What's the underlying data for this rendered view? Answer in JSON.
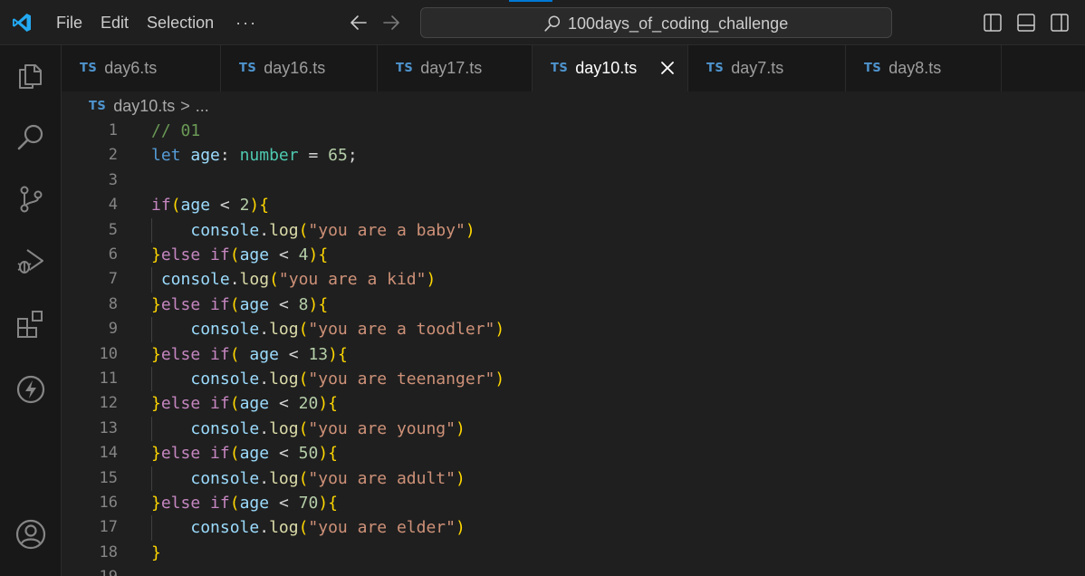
{
  "titlebar": {
    "menu": [
      "File",
      "Edit",
      "Selection",
      "···"
    ],
    "command_center_text": "100days_of_coding_challenge"
  },
  "tabs": [
    {
      "badge": "TS",
      "label": "day6.ts",
      "active": false
    },
    {
      "badge": "TS",
      "label": "day16.ts",
      "active": false
    },
    {
      "badge": "TS",
      "label": "day17.ts",
      "active": false
    },
    {
      "badge": "TS",
      "label": "day10.ts",
      "active": true
    },
    {
      "badge": "TS",
      "label": "day7.ts",
      "active": false
    },
    {
      "badge": "TS",
      "label": "day8.ts",
      "active": false
    }
  ],
  "breadcrumb": {
    "badge": "TS",
    "file": "day10.ts",
    "separator": ">",
    "rest": "..."
  },
  "code_lines": [
    {
      "n": "1",
      "text": "// 01"
    },
    {
      "n": "2",
      "text": "let age: number = 65;"
    },
    {
      "n": "3",
      "text": ""
    },
    {
      "n": "4",
      "text": "if(age < 2){"
    },
    {
      "n": "5",
      "text": "    console.log(\"you are a baby\")"
    },
    {
      "n": "6",
      "text": "}else if(age < 4){"
    },
    {
      "n": "7",
      "text": " console.log(\"you are a kid\")"
    },
    {
      "n": "8",
      "text": "}else if(age < 8){"
    },
    {
      "n": "9",
      "text": "    console.log(\"you are a toodler\")"
    },
    {
      "n": "10",
      "text": "}else if( age < 13){"
    },
    {
      "n": "11",
      "text": "    console.log(\"you are teenanger\")"
    },
    {
      "n": "12",
      "text": "}else if(age < 20){"
    },
    {
      "n": "13",
      "text": "    console.log(\"you are young\")"
    },
    {
      "n": "14",
      "text": "}else if(age < 50){"
    },
    {
      "n": "15",
      "text": "    console.log(\"you are adult\")"
    },
    {
      "n": "16",
      "text": "}else if(age < 70){"
    },
    {
      "n": "17",
      "text": "    console.log(\"you are elder\")"
    },
    {
      "n": "18",
      "text": "}"
    },
    {
      "n": "19",
      "text": ""
    }
  ],
  "colors": {
    "accent": "#0078d4",
    "ts_badge": "#4e94ce",
    "keyword": "#569cd6",
    "control": "#c586c0",
    "variable": "#9cdcfe",
    "type": "#4ec9b0",
    "number": "#b5cea8",
    "string": "#ce9178",
    "comment": "#6a9955",
    "function": "#dcdcaa",
    "bracket_1": "#ffd700",
    "bracket_2": "#da70d6"
  },
  "icons": {
    "activitybar": [
      "explorer-icon",
      "search-icon",
      "source-control-icon",
      "run-debug-icon",
      "extensions-icon",
      "lightning-icon",
      "account-icon"
    ],
    "titlebar": [
      "vscode-logo-icon",
      "arrow-left-icon",
      "arrow-right-icon",
      "search-icon",
      "toggle-primary-sidebar-icon",
      "toggle-panel-icon",
      "toggle-secondary-sidebar-icon"
    ]
  }
}
